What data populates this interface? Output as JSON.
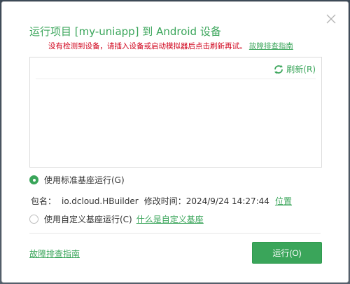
{
  "dialog": {
    "title": "运行项目 [my-uniapp] 到 Android 设备",
    "warning_text": "没有检测到设备，请插入设备或启动模拟器后点击刷新再试。",
    "troubleshoot_link": "故障排查指南",
    "refresh_label": "刷新(R)",
    "standard_base": {
      "label": "使用标准基座运行(G)",
      "checked": true,
      "package_label": "包名：",
      "package_name": "io.dcloud.HBuilder",
      "modified_label": "修改时间：",
      "modified_time": "2024/9/24 14:27:44",
      "location_link": "位置"
    },
    "custom_base": {
      "label": "使用自定义基座运行(C)",
      "checked": false,
      "help_link": "什么是自定义基座"
    },
    "footer_link": "故障排查指南",
    "run_button": "运行(O)"
  },
  "colors": {
    "accent": "#3aa55a",
    "warning": "#d0021b"
  },
  "icons": {
    "close": "close-icon",
    "refresh": "refresh-icon"
  }
}
